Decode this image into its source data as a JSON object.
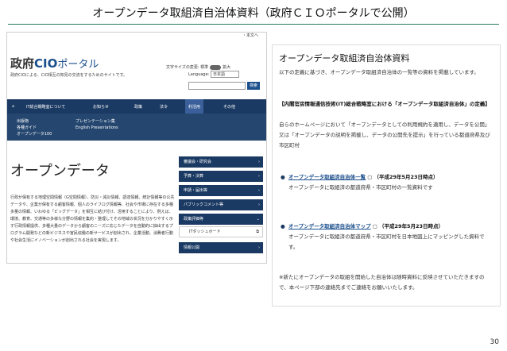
{
  "slide": {
    "title": "オープンデータ取組済自治体資料（政府ＣＩＯポータルで公開）",
    "page_number": "30"
  },
  "left_screenshot": {
    "logo_main": "政府",
    "logo_cio": "CIO",
    "logo_portal": "ポータル",
    "tagline": "政府CIOによる、CIO相互の知見の交流をするためのサイトです。",
    "top_links": "・本文へ",
    "text_size_label": "文字サイズの変更: 標準",
    "text_size_large": "拡大",
    "language_label": "Language:",
    "language_value": "日本語",
    "search_button": "検索",
    "nav": [
      {
        "label": "IT総合戦略室について"
      },
      {
        "label": "お知らせ"
      },
      {
        "label": "政策"
      },
      {
        "label": "法令"
      },
      {
        "label": "利活用"
      },
      {
        "label": "その他"
      }
    ],
    "dropdown_col1": [
      "出版物",
      "各種ガイド",
      "オープンデータ100"
    ],
    "dropdown_col2": [
      "プレゼンテーション集",
      "English Presentations"
    ],
    "heading": "オープンデータ",
    "body": "行政が保有する地理空間情報（G空間情報）、防災・減災情報、調達情報、統計情報等の公共データや、企業が保有する顧客情報、個人のライフログ情報等、社会や市場に存在する多種多量の情報、いわゆる「ビッグデータ」を相互に結び付け、活用することにより、例えば、環境、教育、交通等の多様な分野の情報を集約・整理してその地域の状況を分かりやすく示す行政情報提供、多種大量のデータから顧客のニーズに応じたデータを自動的に抽出するプログラム開発などの新ビジネスや官民協働の新サービスが創出され、企業活動、消費者行動や社会生活にイノベーションが創出される社会を実現します。",
    "side_menu": [
      {
        "label": "審議会・研究会"
      },
      {
        "label": "予算・決算"
      },
      {
        "label": "申請・届出等"
      },
      {
        "label": "パブリックコメント等"
      },
      {
        "label": "政策評価等"
      }
    ],
    "side_sub": "ITダッシュボード",
    "side_last": "情報公開"
  },
  "right_panel": {
    "title": "オープンデータ取組済自治体資料",
    "description": "以下の定義に基づき、オープンデータ取組済自治体の一覧等の資料を掲載しています。",
    "definition_heading": "【内閣官房情報通信技術(IT)総合戦略室における「オープンデータ取組済自治体」の定義】",
    "definition_body": "自らのホームページにおいて「オープンデータとしての利用規約を適用し、データを公開」又は「オープンデータの説明を掲載し、データの公開先を提示」を行っている都道府県及び市区町村",
    "items": [
      {
        "link": "オープンデータ取組済自治体一覧",
        "date": "（平成29年5月23日時点）",
        "desc": "オープンデータに取組済の都道府県・市区町村の一覧資料です"
      },
      {
        "link": "オープンデータ取組済自治体マップ",
        "date": "（平成29年5月23日時点）",
        "desc": "オープンデータに取組済の都道府県・市区町村を日本地図上にマッピングした資料です。"
      }
    ],
    "note": "※新たにオープンデータの取組を開始した自治体は随時資料に反映させていただきますので、本ページ下部の連絡先までご連絡をお願いいたします。"
  }
}
